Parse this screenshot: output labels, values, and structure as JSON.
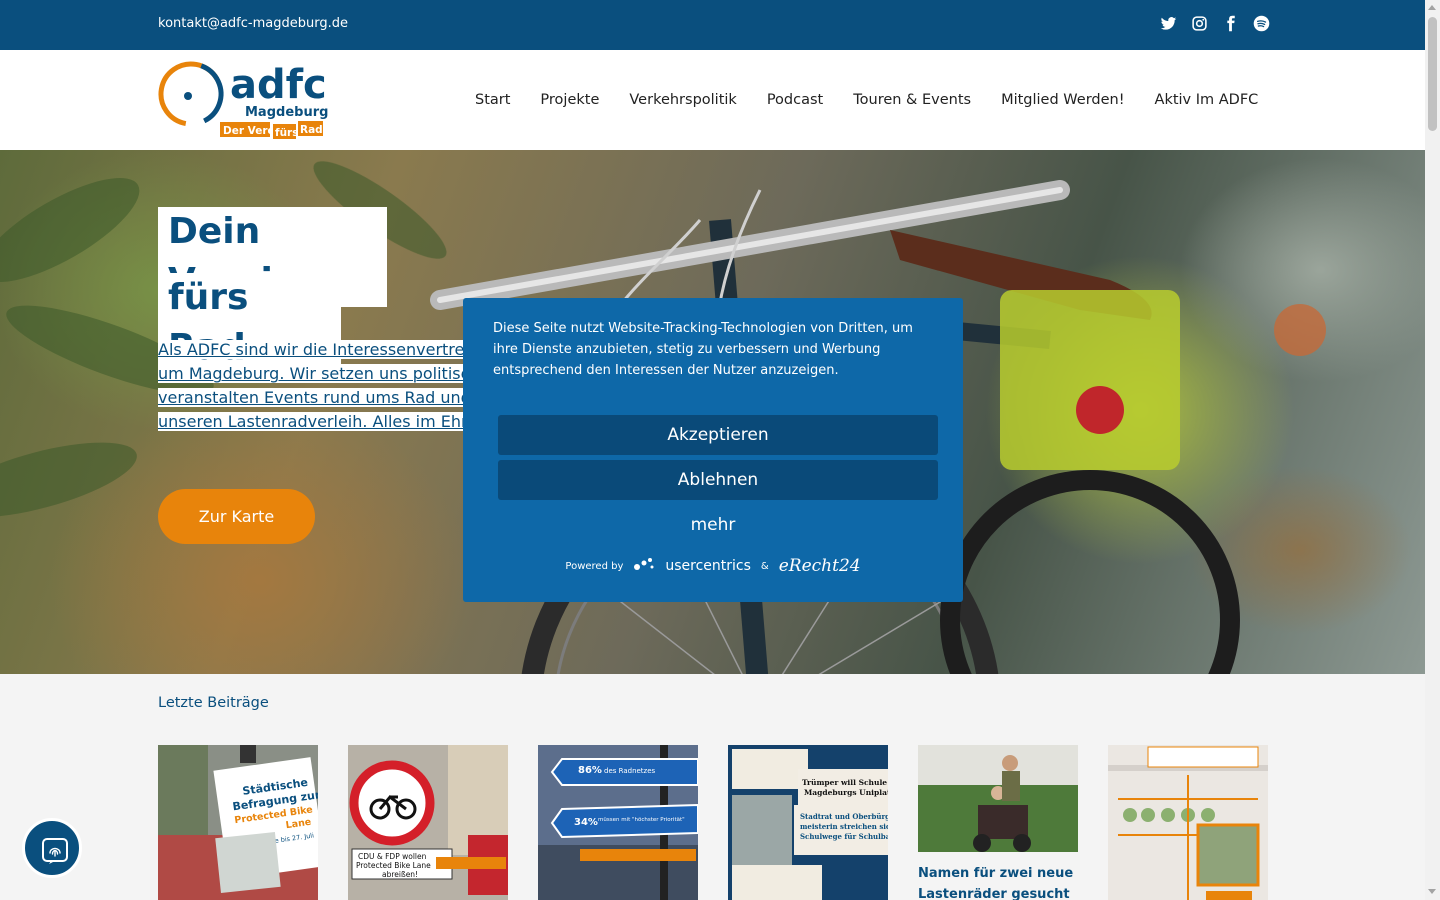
{
  "topbar": {
    "email": "kontakt@adfc-magdeburg.de",
    "socials": [
      "twitter-icon",
      "instagram-icon",
      "facebook-icon",
      "spotify-icon"
    ]
  },
  "logo": {
    "brand": "adfc",
    "city": "Magdeburg",
    "slogan_1": "Der Verein",
    "slogan_2": "fürs",
    "slogan_3": "Rad!"
  },
  "nav": {
    "items": [
      "Start",
      "Projekte",
      "Verkehrspolitik",
      "Podcast",
      "Touren & Events",
      "Mitglied Werden!",
      "Aktiv Im ADFC"
    ]
  },
  "hero": {
    "title_line_1": "Dein Verein",
    "title_line_2": "fürs Rad",
    "intro_lines": [
      "Als ADFC sind wir die Interessenvertretu",
      "um Magdeburg. Wir setzen uns politisc",
      "veranstalten Events rund ums Rad und",
      "unseren Lastenradverleih. Alles im Ehre"
    ],
    "cta_label": "Zur Karte"
  },
  "consent": {
    "message": "Diese Seite nutzt Website-Tracking-Technologien von Dritten, um ihre Dienste anzubieten, stetig zu verbessern und Werbung entsprechend den Interessen der Nutzer anzuzeigen.",
    "accept_label": "Akzeptieren",
    "decline_label": "Ablehnen",
    "more_label": "mehr",
    "powered_by": "Powered by",
    "provider_1": "usercentrics",
    "ampersand": "&",
    "provider_2": "eRecht24"
  },
  "posts": {
    "section_title": "Letzte Beiträge",
    "card5_title": "Namen für zwei neue Lastenräder gesucht",
    "card1": {
      "l1": "Städtische",
      "l2": "Befragung zur",
      "l3": "Protected Bike",
      "l4": "Lane",
      "l5": "Online bis 27. Juli"
    },
    "card2": {
      "l1": "CDU & FDP wollen",
      "l2": "Protected Bike Lane",
      "l3": "abreißen!"
    },
    "card3": {
      "n1": "86%",
      "t1": "des Radnetzes",
      "n2": "34%",
      "t2": "müssen mit \"höchster Priorität\""
    },
    "card4": {
      "l1": "Trümper will Schule au",
      "l2": "Magdeburgs Uniplatz",
      "l3": "Stadtrat und Oberbürger-",
      "l4": "meisterin streichen sichere",
      "l5": "Schulwege für Schulbau"
    }
  },
  "colors": {
    "brand_blue": "#0a4f7e",
    "consent_blue": "#0e68a8",
    "accent_orange": "#e8840b"
  }
}
